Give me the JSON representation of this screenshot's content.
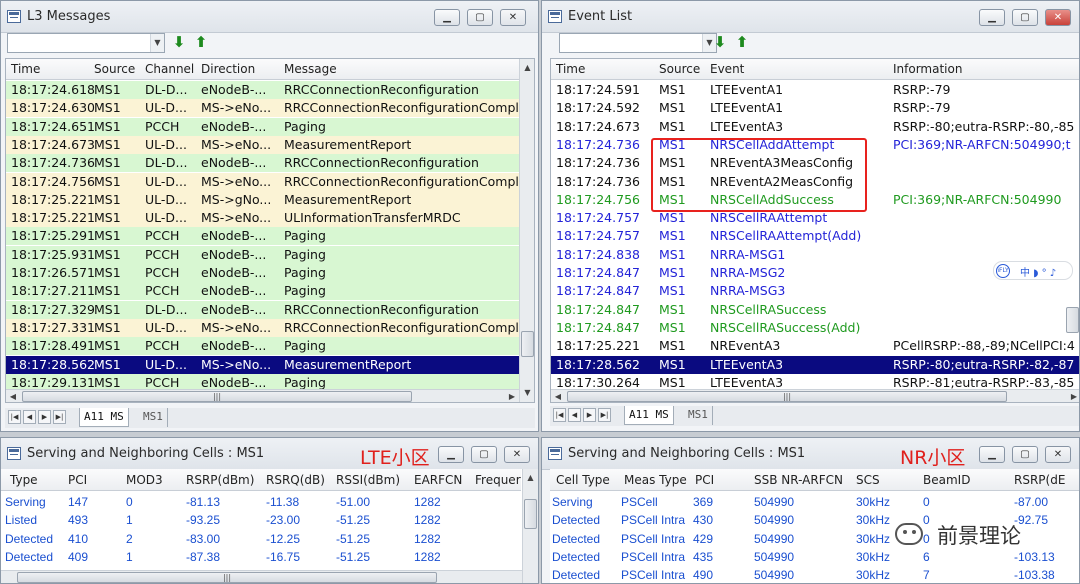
{
  "l3": {
    "title": "L3 Messages",
    "headers": [
      "Time",
      "Source",
      "Channel",
      "Direction",
      "Message"
    ],
    "rows": [
      {
        "time": "18:17:24.618",
        "src": "MS1",
        "ch": "DL-D...",
        "dir": "eNodeB-...",
        "msg": "RRCConnectionReconfiguration",
        "bg": "#d8f7d2",
        "fg": "#111"
      },
      {
        "time": "18:17:24.630",
        "src": "MS1",
        "ch": "UL-D...",
        "dir": "MS->eNo...",
        "msg": "RRCConnectionReconfigurationComple",
        "bg": "#fbf3d5",
        "fg": "#111"
      },
      {
        "time": "18:17:24.651",
        "src": "MS1",
        "ch": "PCCH",
        "dir": "eNodeB-...",
        "msg": "Paging",
        "bg": "#d8f7d2",
        "fg": "#111"
      },
      {
        "time": "18:17:24.673",
        "src": "MS1",
        "ch": "UL-D...",
        "dir": "MS->eNo...",
        "msg": "MeasurementReport",
        "bg": "#fbf3d5",
        "fg": "#111"
      },
      {
        "time": "18:17:24.736",
        "src": "MS1",
        "ch": "DL-D...",
        "dir": "eNodeB-...",
        "msg": "RRCConnectionReconfiguration",
        "bg": "#d8f7d2",
        "fg": "#111"
      },
      {
        "time": "18:17:24.756",
        "src": "MS1",
        "ch": "UL-D...",
        "dir": "MS->eNo...",
        "msg": "RRCConnectionReconfigurationComple",
        "bg": "#fbf3d5",
        "fg": "#111"
      },
      {
        "time": "18:17:25.221",
        "src": "MS1",
        "ch": "UL-D...",
        "dir": "MS->gNo...",
        "msg": "MeasurementReport",
        "bg": "#fbf3d5",
        "fg": "#111"
      },
      {
        "time": "18:17:25.221",
        "src": "MS1",
        "ch": "UL-D...",
        "dir": "MS->eNo...",
        "msg": "ULInformationTransferMRDC",
        "bg": "#fbf3d5",
        "fg": "#111"
      },
      {
        "time": "18:17:25.291",
        "src": "MS1",
        "ch": "PCCH",
        "dir": "eNodeB-...",
        "msg": "Paging",
        "bg": "#d8f7d2",
        "fg": "#111"
      },
      {
        "time": "18:17:25.931",
        "src": "MS1",
        "ch": "PCCH",
        "dir": "eNodeB-...",
        "msg": "Paging",
        "bg": "#d8f7d2",
        "fg": "#111"
      },
      {
        "time": "18:17:26.571",
        "src": "MS1",
        "ch": "PCCH",
        "dir": "eNodeB-...",
        "msg": "Paging",
        "bg": "#d8f7d2",
        "fg": "#111"
      },
      {
        "time": "18:17:27.211",
        "src": "MS1",
        "ch": "PCCH",
        "dir": "eNodeB-...",
        "msg": "Paging",
        "bg": "#d8f7d2",
        "fg": "#111"
      },
      {
        "time": "18:17:27.329",
        "src": "MS1",
        "ch": "DL-D...",
        "dir": "eNodeB-...",
        "msg": "RRCConnectionReconfiguration",
        "bg": "#d8f7d2",
        "fg": "#111"
      },
      {
        "time": "18:17:27.331",
        "src": "MS1",
        "ch": "UL-D...",
        "dir": "MS->eNo...",
        "msg": "RRCConnectionReconfigurationComple",
        "bg": "#fbf3d5",
        "fg": "#111"
      },
      {
        "time": "18:17:28.491",
        "src": "MS1",
        "ch": "PCCH",
        "dir": "eNodeB-...",
        "msg": "Paging",
        "bg": "#d8f7d2",
        "fg": "#111"
      },
      {
        "time": "18:17:28.562",
        "src": "MS1",
        "ch": "UL-D...",
        "dir": "MS->eNo...",
        "msg": "MeasurementReport",
        "bg": "#0a0a80",
        "fg": "#ffffff"
      },
      {
        "time": "18:17:29.131",
        "src": "MS1",
        "ch": "PCCH",
        "dir": "eNodeB-...",
        "msg": "Paging",
        "bg": "#d8f7d2",
        "fg": "#111"
      }
    ],
    "tabs": [
      "A11 MS",
      "MS1"
    ]
  },
  "events": {
    "title": "Event List",
    "headers": [
      "Time",
      "Source",
      "Event",
      "Information"
    ],
    "rows": [
      {
        "time": "18:17:24.591",
        "src": "MS1",
        "ev": "LTEEventA1",
        "info": "RSRP:-79",
        "bg": "#ffffff",
        "fg": "#111"
      },
      {
        "time": "18:17:24.592",
        "src": "MS1",
        "ev": "LTEEventA1",
        "info": "RSRP:-79",
        "bg": "#ffffff",
        "fg": "#111"
      },
      {
        "time": "18:17:24.673",
        "src": "MS1",
        "ev": "LTEEventA3",
        "info": "RSRP:-80;eutra-RSRP:-80,-85",
        "bg": "#ffffff",
        "fg": "#111"
      },
      {
        "time": "18:17:24.736",
        "src": "MS1",
        "ev": "NRSCellAddAttempt",
        "info": "PCI:369;NR-ARFCN:504990;t",
        "bg": "#ffffff",
        "fg": "#2323d8"
      },
      {
        "time": "18:17:24.736",
        "src": "MS1",
        "ev": "NREventA3MeasConfig",
        "info": "",
        "bg": "#ffffff",
        "fg": "#111"
      },
      {
        "time": "18:17:24.736",
        "src": "MS1",
        "ev": "NREventA2MeasConfig",
        "info": "",
        "bg": "#ffffff",
        "fg": "#111"
      },
      {
        "time": "18:17:24.756",
        "src": "MS1",
        "ev": "NRSCellAddSuccess",
        "info": "PCI:369;NR-ARFCN:504990",
        "bg": "#ffffff",
        "fg": "#1f9a1f"
      },
      {
        "time": "18:17:24.757",
        "src": "MS1",
        "ev": "NRSCellRAAttempt",
        "info": "",
        "bg": "#ffffff",
        "fg": "#2323d8"
      },
      {
        "time": "18:17:24.757",
        "src": "MS1",
        "ev": "NRSCellRAAttempt(Add)",
        "info": "",
        "bg": "#ffffff",
        "fg": "#2323d8"
      },
      {
        "time": "18:17:24.838",
        "src": "MS1",
        "ev": "NRRA-MSG1",
        "info": "",
        "bg": "#ffffff",
        "fg": "#2323d8"
      },
      {
        "time": "18:17:24.847",
        "src": "MS1",
        "ev": "NRRA-MSG2",
        "info": "",
        "bg": "#ffffff",
        "fg": "#2323d8"
      },
      {
        "time": "18:17:24.847",
        "src": "MS1",
        "ev": "NRRA-MSG3",
        "info": "",
        "bg": "#ffffff",
        "fg": "#2323d8"
      },
      {
        "time": "18:17:24.847",
        "src": "MS1",
        "ev": "NRSCellRASuccess",
        "info": "",
        "bg": "#ffffff",
        "fg": "#1f9a1f"
      },
      {
        "time": "18:17:24.847",
        "src": "MS1",
        "ev": "NRSCellRASuccess(Add)",
        "info": "",
        "bg": "#ffffff",
        "fg": "#1f9a1f"
      },
      {
        "time": "18:17:25.221",
        "src": "MS1",
        "ev": "NREventA3",
        "info": "PCellRSRP:-88,-89;NCellPCI:4",
        "bg": "#ffffff",
        "fg": "#111"
      },
      {
        "time": "18:17:28.562",
        "src": "MS1",
        "ev": "LTEEventA3",
        "info": "RSRP:-80;eutra-RSRP:-82,-87",
        "bg": "#0a0a80",
        "fg": "#ffffff"
      },
      {
        "time": "18:17:30.264",
        "src": "MS1",
        "ev": "LTEEventA3",
        "info": "RSRP:-81;eutra-RSRP:-83,-85",
        "bg": "#ffffff",
        "fg": "#111"
      }
    ],
    "tabs": [
      "A11 MS",
      "MS1"
    ]
  },
  "lte": {
    "title": "Serving and Neighboring Cells : MS1",
    "annotation": "LTE小区",
    "headers": [
      "Type",
      "PCI",
      "MOD3",
      "RSRP(dBm)",
      "RSRQ(dB)",
      "RSSI(dBm)",
      "EARFCN",
      "Frequer"
    ],
    "rows": [
      [
        "Serving",
        "147",
        "0",
        "-81.13",
        "-11.38",
        "-51.00",
        "1282"
      ],
      [
        "Listed",
        "493",
        "1",
        "-93.25",
        "-23.00",
        "-51.25",
        "1282"
      ],
      [
        "Detected",
        "410",
        "2",
        "-83.00",
        "-12.25",
        "-51.25",
        "1282"
      ],
      [
        "Detected",
        "409",
        "1",
        "-87.38",
        "-16.75",
        "-51.25",
        "1282"
      ]
    ]
  },
  "nr": {
    "title": "Serving and Neighboring Cells : MS1",
    "annotation": "NR小区",
    "headers": [
      "Cell Type",
      "Meas Type",
      "PCI",
      "SSB NR-ARFCN",
      "SCS",
      "BeamID",
      "RSRP(dE"
    ],
    "rows": [
      [
        "Serving",
        "PSCell",
        "369",
        "504990",
        "30kHz",
        "0",
        "-87.00"
      ],
      [
        "Detected",
        "PSCell Intra",
        "430",
        "504990",
        "30kHz",
        "0",
        "-92.75"
      ],
      [
        "Detected",
        "PSCell Intra",
        "429",
        "504990",
        "30kHz",
        "0",
        ""
      ],
      [
        "Detected",
        "PSCell Intra",
        "435",
        "504990",
        "30kHz",
        "6",
        "-103.13"
      ],
      [
        "Detected",
        "PSCell Intra",
        "490",
        "504990",
        "30kHz",
        "7",
        "-103.38"
      ]
    ]
  },
  "overlay": {
    "ifly_logo": "iFLY",
    "ifly_items": "中 ◗ ° ♪",
    "watermark": "前景理论"
  }
}
